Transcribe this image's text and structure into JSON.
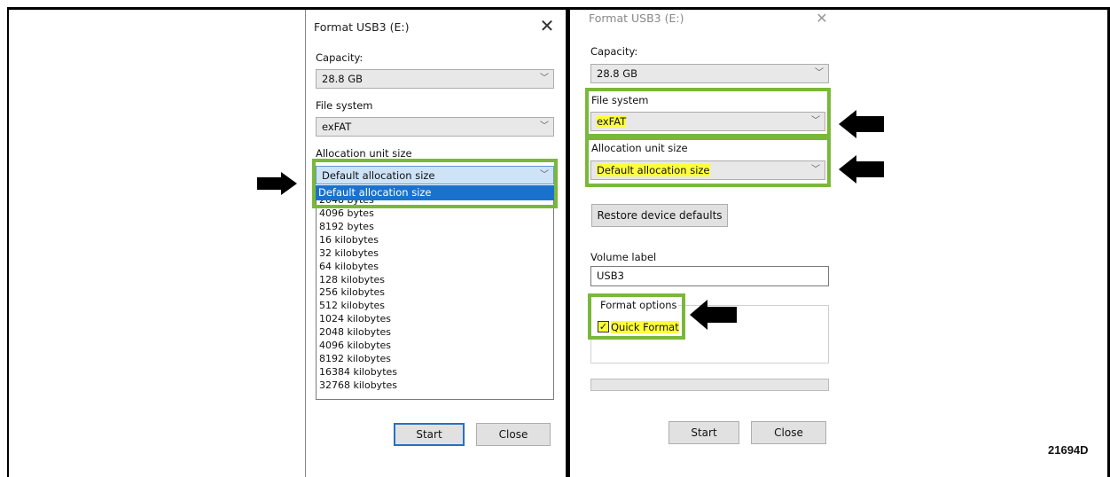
{
  "figure_code": "21694D",
  "left_dialog": {
    "title": "Format USB3 (E:)",
    "capacity_label": "Capacity:",
    "capacity_value": "28.8 GB",
    "file_system_label": "File system",
    "file_system_value": "exFAT",
    "allocation_label": "Allocation unit size",
    "allocation_value": "Default allocation size",
    "dropdown_selected": "Default allocation size",
    "dropdown_partial": "2048 bytes",
    "dropdown_options": [
      "4096 bytes",
      "8192 bytes",
      "16 kilobytes",
      "32 kilobytes",
      "64 kilobytes",
      "128 kilobytes",
      "256 kilobytes",
      "512 kilobytes",
      "1024 kilobytes",
      "2048 kilobytes",
      "4096 kilobytes",
      "8192 kilobytes",
      "16384 kilobytes",
      "32768 kilobytes"
    ],
    "start_label": "Start",
    "close_label": "Close"
  },
  "right_dialog": {
    "title": "Format USB3 (E:)",
    "capacity_label": "Capacity:",
    "capacity_value": "28.8 GB",
    "file_system_label": "File system",
    "file_system_value": "exFAT",
    "allocation_label": "Allocation unit size",
    "allocation_value": "Default allocation size",
    "restore_label": "Restore device defaults",
    "volume_label_label": "Volume label",
    "volume_label_value": "USB3",
    "format_options_label": "Format options",
    "quick_format_label": "Quick Format",
    "quick_format_checked": true,
    "progress": 0,
    "start_label": "Start",
    "close_label": "Close"
  },
  "colors": {
    "highlight_green": "#79b83a",
    "highlight_yellow": "#ffff3a",
    "selection_blue": "#1b72cc"
  }
}
